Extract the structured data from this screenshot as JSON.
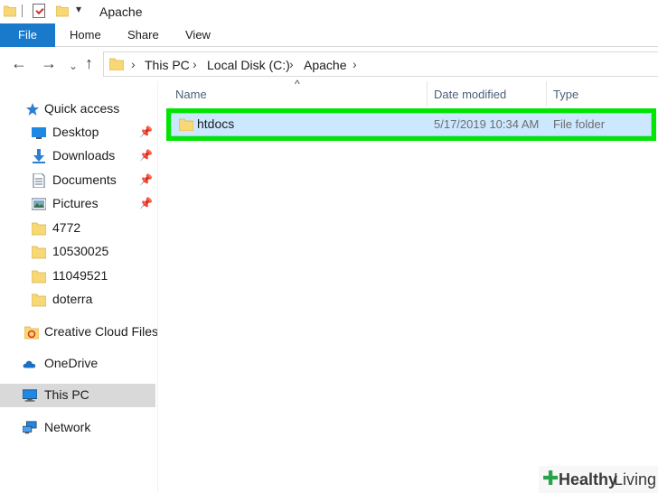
{
  "titlebar": {
    "title": "Apache",
    "dropdown_glyph": "▾"
  },
  "ribbon": {
    "file": "File",
    "home": "Home",
    "share": "Share",
    "view": "View"
  },
  "address": {
    "back_glyph": "←",
    "forward_glyph": "→",
    "recent_glyph": "⌄",
    "up_glyph": "↑",
    "crumbs": [
      "This PC",
      "Local Disk (C:)",
      "Apache"
    ],
    "chevron": "›"
  },
  "navpane": {
    "quick_access": "Quick access",
    "items": [
      {
        "label": "Desktop",
        "pinned": true,
        "icon": "desktop-icon"
      },
      {
        "label": "Downloads",
        "pinned": true,
        "icon": "downloads-icon"
      },
      {
        "label": "Documents",
        "pinned": true,
        "icon": "documents-icon"
      },
      {
        "label": "Pictures",
        "pinned": true,
        "icon": "pictures-icon"
      },
      {
        "label": "4772",
        "pinned": false,
        "icon": "folder-icon"
      },
      {
        "label": "10530025",
        "pinned": false,
        "icon": "folder-icon"
      },
      {
        "label": "11049521",
        "pinned": false,
        "icon": "folder-icon"
      },
      {
        "label": "doterra",
        "pinned": false,
        "icon": "folder-icon"
      }
    ],
    "creative_cloud": "Creative Cloud Files",
    "onedrive": "OneDrive",
    "this_pc": "This PC",
    "network": "Network",
    "pin_glyph": "📌"
  },
  "content": {
    "sort_glyph": "^",
    "columns": {
      "name": "Name",
      "date": "Date modified",
      "type": "Type"
    },
    "rows": [
      {
        "name": "htdocs",
        "date": "5/17/2019 10:34 AM",
        "type": "File folder"
      }
    ]
  },
  "watermark": {
    "plus": "✚",
    "word1": "Healthy",
    "word2": "Living"
  },
  "colors": {
    "file_tab": "#1979ca",
    "highlight": "#00e600",
    "selection": "#cce8ff",
    "folder": "#f8d775"
  }
}
